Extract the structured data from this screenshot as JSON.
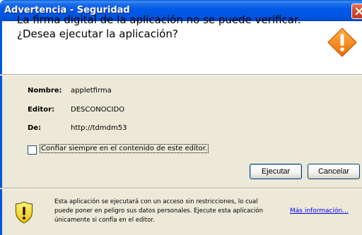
{
  "window": {
    "title": "Advertencia - Seguridad"
  },
  "header": {
    "message_line1": "La firma digital de la aplicación no se puede verificar.",
    "message_line2": "¿Desea ejecutar la aplicación?",
    "icon": "warning-diamond-icon"
  },
  "details": {
    "name_label": "Nombre:",
    "name_value": "appletfirma",
    "publisher_label": "Editor:",
    "publisher_value": "DESCONOCIDO",
    "from_label": "De:",
    "from_value": "http://tdmdm53"
  },
  "checkbox": {
    "label": "Confiar siempre en el contenido de este editor.",
    "checked": false
  },
  "buttons": {
    "run": "Ejecutar",
    "cancel": "Cancelar"
  },
  "footer": {
    "line1": "Esta aplicación se ejecutará con un acceso sin restricciones, lo cual",
    "line2": "puede poner en peligro sus datos personales. Ejecute esta aplicación",
    "line3": "únicamente si confía en el editor.",
    "more_info": "Más información...",
    "icon": "shield-warning-icon"
  },
  "colors": {
    "titlebar": "#0055e0",
    "warning": "#ff8c00",
    "shield": "#ffd700",
    "link": "#0000ee"
  }
}
